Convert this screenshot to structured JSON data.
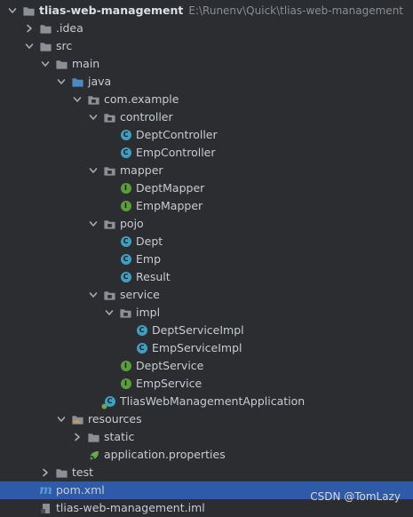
{
  "project": {
    "name": "tlias-web-management",
    "path": "E:\\Runenv\\Quick\\tlias-web-management"
  },
  "tree": {
    "idea": ".idea",
    "src": "src",
    "main": "main",
    "java": "java",
    "package": "com.example",
    "controller": "controller",
    "dept_controller": "DeptController",
    "emp_controller": "EmpController",
    "mapper": "mapper",
    "dept_mapper": "DeptMapper",
    "emp_mapper": "EmpMapper",
    "pojo": "pojo",
    "dept": "Dept",
    "emp": "Emp",
    "result": "Result",
    "service": "service",
    "impl": "impl",
    "dept_service_impl": "DeptServiceImpl",
    "emp_service_impl": "EmpServiceImpl",
    "dept_service": "DeptService",
    "emp_service": "EmpService",
    "application": "TliasWebManagementApplication",
    "resources": "resources",
    "static": "static",
    "properties": "application.properties",
    "test": "test",
    "pom": "pom.xml",
    "iml": "tlias-web-management.iml"
  },
  "badges": {
    "class": "C",
    "interface": "I",
    "maven": "m"
  },
  "colors": {
    "background": "#2b2d30",
    "selected": "#2f5aa8",
    "class_icon": "#3f9fc2",
    "interface_icon": "#5a9e3a",
    "folder": "#8c8f94",
    "source_folder": "#4d88c7",
    "spring_green": "#6aa84f"
  },
  "watermark": "CSDN @TomLazy"
}
